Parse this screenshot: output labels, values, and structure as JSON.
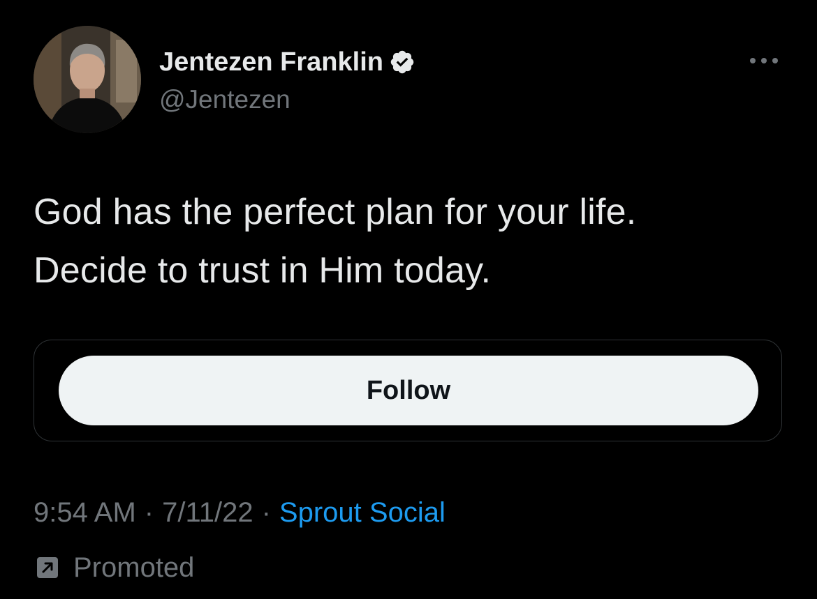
{
  "author": {
    "display_name": "Jentezen Franklin",
    "handle": "@Jentezen",
    "verified": true,
    "avatar_icon": "profile-photo"
  },
  "tweet": {
    "lines": [
      "God has the perfect plan for your life.",
      "Decide to trust in Him today."
    ]
  },
  "card": {
    "follow_label": "Follow"
  },
  "meta": {
    "time": "9:54 AM",
    "separator": "·",
    "date": "7/11/22",
    "source": "Sprout Social"
  },
  "promoted": {
    "label": "Promoted",
    "icon": "promoted-arrow-icon"
  },
  "colors": {
    "background": "#000000",
    "text_primary": "#e7e9ea",
    "text_secondary": "#71767b",
    "link": "#1d9bf0",
    "button_bg": "#eff3f4",
    "button_text": "#0f1419",
    "card_border": "#2f3336"
  }
}
